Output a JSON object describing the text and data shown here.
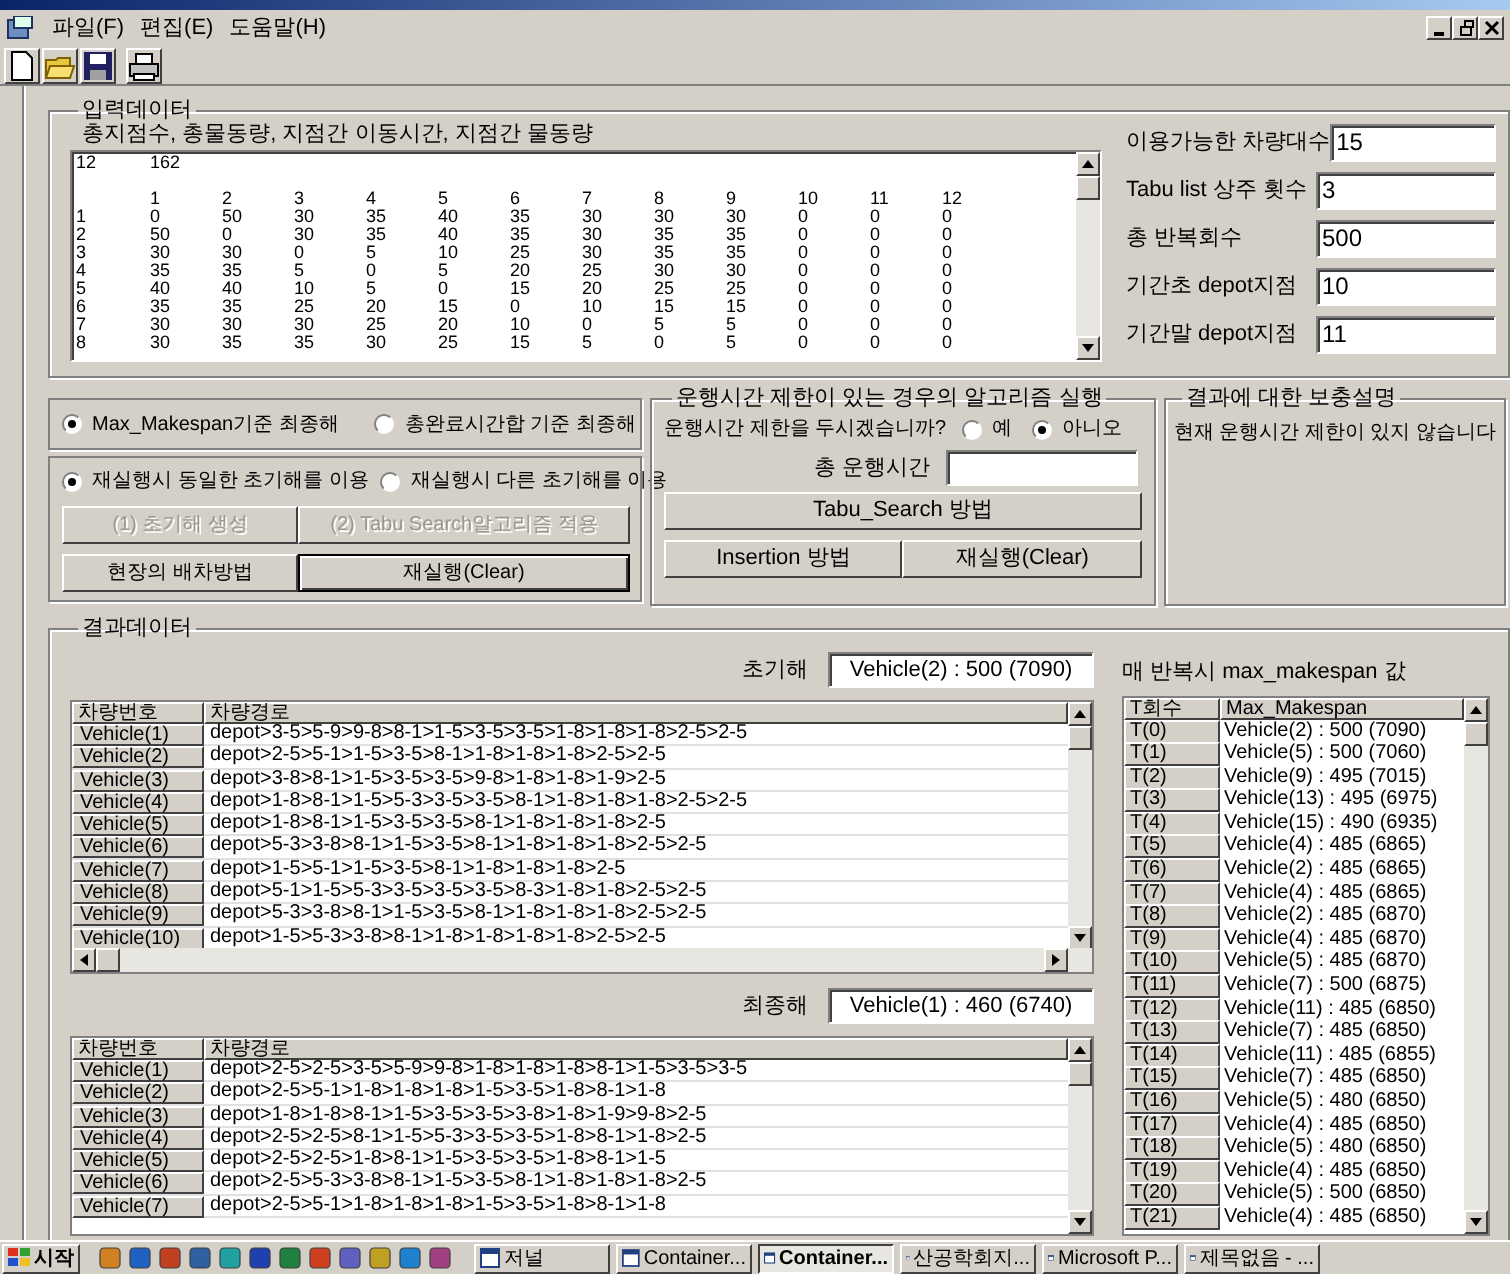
{
  "menu": [
    "파일(F)",
    "편집(E)",
    "도움말(H)"
  ],
  "input_data": {
    "title": "입력데이터",
    "caption": "총지점수, 총물동량, 지점간  이동시간, 지점간 물동량",
    "matrix": {
      "first_line": [
        "12",
        "162"
      ],
      "column_headers": [
        "1",
        "2",
        "3",
        "4",
        "5",
        "6",
        "7",
        "8",
        "9",
        "10",
        "11",
        "12"
      ],
      "rows": [
        {
          "label": "1",
          "values": [
            "0",
            "50",
            "30",
            "35",
            "40",
            "35",
            "30",
            "30",
            "30",
            "0",
            "0",
            "0"
          ]
        },
        {
          "label": "2",
          "values": [
            "50",
            "0",
            "30",
            "35",
            "40",
            "35",
            "30",
            "35",
            "35",
            "0",
            "0",
            "0"
          ]
        },
        {
          "label": "3",
          "values": [
            "30",
            "30",
            "0",
            "5",
            "10",
            "25",
            "30",
            "35",
            "35",
            "0",
            "0",
            "0"
          ]
        },
        {
          "label": "4",
          "values": [
            "35",
            "35",
            "5",
            "0",
            "5",
            "20",
            "25",
            "30",
            "30",
            "0",
            "0",
            "0"
          ]
        },
        {
          "label": "5",
          "values": [
            "40",
            "40",
            "10",
            "5",
            "0",
            "15",
            "20",
            "25",
            "25",
            "0",
            "0",
            "0"
          ]
        },
        {
          "label": "6",
          "values": [
            "35",
            "35",
            "25",
            "20",
            "15",
            "0",
            "10",
            "15",
            "15",
            "0",
            "0",
            "0"
          ]
        },
        {
          "label": "7",
          "values": [
            "30",
            "30",
            "30",
            "25",
            "20",
            "10",
            "0",
            "5",
            "5",
            "0",
            "0",
            "0"
          ]
        },
        {
          "label": "8",
          "values": [
            "30",
            "35",
            "35",
            "30",
            "25",
            "15",
            "5",
            "0",
            "5",
            "0",
            "0",
            "0"
          ]
        }
      ]
    }
  },
  "parameters": [
    {
      "label": "이용가능한 차량대수",
      "value": "15"
    },
    {
      "label": "Tabu list 상주 횟수",
      "value": "3"
    },
    {
      "label": "총 반복회수",
      "value": "500"
    },
    {
      "label": "기간초 depot지점",
      "value": "10"
    },
    {
      "label": "기간말 depot지점",
      "value": "11"
    }
  ],
  "objective": {
    "options": [
      {
        "label": "Max_Makespan기준 최종해",
        "selected": true
      },
      {
        "label": "총완료시간합 기준 최종해",
        "selected": false
      }
    ]
  },
  "rerun": {
    "options": [
      {
        "label": "재실행시 동일한 초기해를 이용",
        "selected": true
      },
      {
        "label": "재실행시 다른 초기해를 이용",
        "selected": false
      }
    ],
    "buttons": [
      {
        "label": "(1) 초기해 생성",
        "disabled": true,
        "default": false
      },
      {
        "label": "(2) Tabu Search알고리즘 적용",
        "disabled": true,
        "default": false
      },
      {
        "label": "현장의 배차방법",
        "disabled": false,
        "default": false
      },
      {
        "label": "재실행(Clear)",
        "disabled": false,
        "default": true
      }
    ]
  },
  "time_limit": {
    "title": "운행시간 제한이 있는 경우의 알고리즘 실행",
    "question": "운행시간 제한을 두시겠습니까?",
    "options": [
      {
        "label": "예",
        "selected": false
      },
      {
        "label": "아니오",
        "selected": true
      }
    ],
    "total_time_label": "총 운행시간",
    "buttons": [
      "Tabu_Search 방법",
      "Insertion 방법",
      "재실행(Clear)"
    ]
  },
  "notes": {
    "title": "결과에 대한 보충설명",
    "text": "현재 운행시간 제한이 있지 않습니다"
  },
  "results": {
    "title": "결과데이터",
    "initial": {
      "label": "초기해",
      "value": "Vehicle(2) : 500 (7090)"
    },
    "initial_table": {
      "columns": [
        "차량번호",
        "차량경로"
      ],
      "rows": [
        {
          "vehicle": "Vehicle(1)",
          "route": "depot>3-5>5-9>9-8>8-1>1-5>3-5>3-5>1-8>1-8>1-8>2-5>2-5"
        },
        {
          "vehicle": "Vehicle(2)",
          "route": "depot>2-5>5-1>1-5>3-5>8-1>1-8>1-8>1-8>2-5>2-5"
        },
        {
          "vehicle": "Vehicle(3)",
          "route": "depot>3-8>8-1>1-5>3-5>3-5>9-8>1-8>1-8>1-9>2-5"
        },
        {
          "vehicle": "Vehicle(4)",
          "route": "depot>1-8>8-1>1-5>5-3>3-5>3-5>8-1>1-8>1-8>1-8>2-5>2-5"
        },
        {
          "vehicle": "Vehicle(5)",
          "route": "depot>1-8>8-1>1-5>3-5>3-5>8-1>1-8>1-8>1-8>2-5"
        },
        {
          "vehicle": "Vehicle(6)",
          "route": "depot>5-3>3-8>8-1>1-5>3-5>8-1>1-8>1-8>1-8>2-5>2-5"
        },
        {
          "vehicle": "Vehicle(7)",
          "route": "depot>1-5>5-1>1-5>3-5>8-1>1-8>1-8>1-8>2-5"
        },
        {
          "vehicle": "Vehicle(8)",
          "route": "depot>5-1>1-5>5-3>3-5>3-5>3-5>8-3>1-8>1-8>2-5>2-5"
        },
        {
          "vehicle": "Vehicle(9)",
          "route": "depot>5-3>3-8>8-1>1-5>3-5>8-1>1-8>1-8>1-8>2-5>2-5"
        },
        {
          "vehicle": "Vehicle(10)",
          "route": "depot>1-5>5-3>3-8>8-1>1-8>1-8>1-8>1-8>2-5>2-5"
        }
      ]
    },
    "final": {
      "label": "최종해",
      "value": "Vehicle(1) : 460 (6740)"
    },
    "final_table": {
      "columns": [
        "차량번호",
        "차량경로"
      ],
      "rows": [
        {
          "vehicle": "Vehicle(1)",
          "route": "depot>2-5>2-5>3-5>5-9>9-8>1-8>1-8>1-8>8-1>1-5>3-5>3-5"
        },
        {
          "vehicle": "Vehicle(2)",
          "route": "depot>2-5>5-1>1-8>1-8>1-8>1-5>3-5>1-8>8-1>1-8"
        },
        {
          "vehicle": "Vehicle(3)",
          "route": "depot>1-8>1-8>8-1>1-5>3-5>3-5>3-8>1-8>1-9>9-8>2-5"
        },
        {
          "vehicle": "Vehicle(4)",
          "route": "depot>2-5>2-5>8-1>1-5>5-3>3-5>3-5>1-8>8-1>1-8>2-5"
        },
        {
          "vehicle": "Vehicle(5)",
          "route": "depot>2-5>2-5>1-8>8-1>1-5>3-5>3-5>1-8>8-1>1-5"
        },
        {
          "vehicle": "Vehicle(6)",
          "route": "depot>2-5>5-3>3-8>8-1>1-5>3-5>8-1>1-8>1-8>1-8>2-5"
        },
        {
          "vehicle": "Vehicle(7)",
          "route": "depot>2-5>5-1>1-8>1-8>1-8>1-5>3-5>1-8>8-1>1-8"
        }
      ]
    },
    "history": {
      "title": "매 반복시 max_makespan 값",
      "columns": [
        "T회수",
        "Max_Makespan"
      ],
      "rows": [
        {
          "t": "T(0)",
          "value": "Vehicle(2) : 500 (7090)"
        },
        {
          "t": "T(1)",
          "value": "Vehicle(5) : 500 (7060)"
        },
        {
          "t": "T(2)",
          "value": "Vehicle(9) : 495 (7015)"
        },
        {
          "t": "T(3)",
          "value": "Vehicle(13) : 495 (6975)"
        },
        {
          "t": "T(4)",
          "value": "Vehicle(15) : 490 (6935)"
        },
        {
          "t": "T(5)",
          "value": "Vehicle(4) : 485 (6865)"
        },
        {
          "t": "T(6)",
          "value": "Vehicle(2) : 485 (6865)"
        },
        {
          "t": "T(7)",
          "value": "Vehicle(4) : 485 (6865)"
        },
        {
          "t": "T(8)",
          "value": "Vehicle(2) : 485 (6870)"
        },
        {
          "t": "T(9)",
          "value": "Vehicle(4) : 485 (6870)"
        },
        {
          "t": "T(10)",
          "value": "Vehicle(5) : 485 (6870)"
        },
        {
          "t": "T(11)",
          "value": "Vehicle(7) : 500 (6875)"
        },
        {
          "t": "T(12)",
          "value": "Vehicle(11) : 485 (6850)"
        },
        {
          "t": "T(13)",
          "value": "Vehicle(7) : 485 (6850)"
        },
        {
          "t": "T(14)",
          "value": "Vehicle(11) : 485 (6855)"
        },
        {
          "t": "T(15)",
          "value": "Vehicle(7) : 485 (6850)"
        },
        {
          "t": "T(16)",
          "value": "Vehicle(5) : 480 (6850)"
        },
        {
          "t": "T(17)",
          "value": "Vehicle(4) : 485 (6850)"
        },
        {
          "t": "T(18)",
          "value": "Vehicle(5) : 480 (6850)"
        },
        {
          "t": "T(19)",
          "value": "Vehicle(4) : 485 (6850)"
        },
        {
          "t": "T(20)",
          "value": "Vehicle(5) : 500 (6850)"
        },
        {
          "t": "T(21)",
          "value": "Vehicle(4) : 485 (6850)"
        }
      ]
    }
  },
  "taskbar": {
    "start": "시작",
    "tasks": [
      {
        "label": "저널",
        "selected": false
      },
      {
        "label": "Container...",
        "selected": false
      },
      {
        "label": "Container...",
        "selected": true
      },
      {
        "label": "산공학회지...",
        "selected": false
      },
      {
        "label": "Microsoft P...",
        "selected": false
      },
      {
        "label": "제목없음 - ...",
        "selected": false
      }
    ]
  }
}
